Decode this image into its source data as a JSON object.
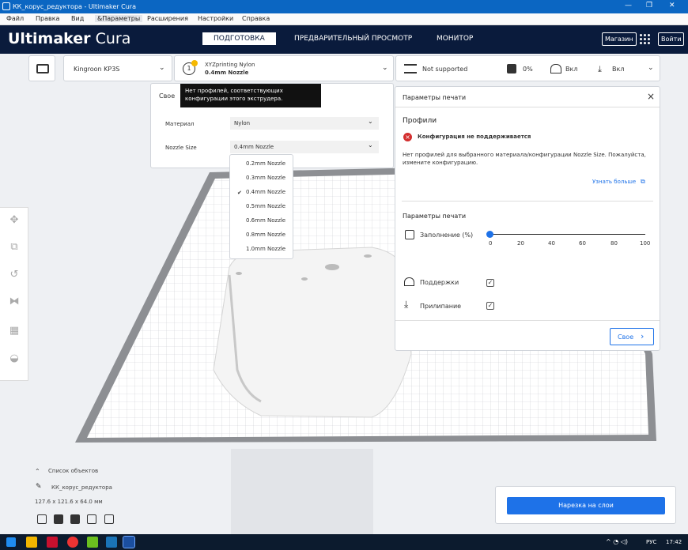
{
  "window": {
    "title": "КК_корус_редуктора - Ultimaker Cura",
    "controls": [
      "—",
      "❐",
      "✕"
    ]
  },
  "menu": [
    "Файл",
    "Правка",
    "Вид",
    "&Параметры",
    "Расширения",
    "Настройки",
    "Справка"
  ],
  "header": {
    "logo_bold": "Ultimaker",
    "logo_light": "Cura",
    "stages": [
      "ПОДГОТОВКА",
      "ПРЕДВАРИТЕЛЬНЫЙ ПРОСМОТР",
      "МОНИТОР"
    ],
    "store": "Магазин",
    "login": "Войти"
  },
  "toolbar": {
    "printer": "Kingroon KP3S",
    "material_name": "XYZprinting Nylon",
    "nozzle": "0.4mm Nozzle",
    "profile": "Not supported",
    "infill_pct": "0%",
    "support": "Вкл",
    "adhesion": "Вкл"
  },
  "tooltip": {
    "text": "Нет профилей, соответствующих конфигурации этого экструдера."
  },
  "extruder_panel": {
    "tab": "Свое",
    "material_label": "Материал",
    "material_value": "Nylon",
    "nozzle_label": "Nozzle Size",
    "nozzle_value": "0.4mm Nozzle"
  },
  "nozzle_options": [
    "0.2mm Nozzle",
    "0.3mm Nozzle",
    "0.4mm Nozzle",
    "0.5mm Nozzle",
    "0.6mm Nozzle",
    "0.8mm Nozzle",
    "1.0mm Nozzle"
  ],
  "nozzle_selected": "0.4mm Nozzle",
  "print_settings": {
    "title": "Параметры печати",
    "profiles_label": "Профили",
    "error": "Конфигурация не поддерживается",
    "error_desc": "Нет профилей для выбранного материала/конфигурации Nozzle Size. Пожалуйста, измените конфигурацию.",
    "learn_more": "Узнать больше",
    "section": "Параметры печати",
    "infill_label": "Заполнение (%)",
    "infill_ticks": [
      "0",
      "20",
      "40",
      "60",
      "80",
      "100"
    ],
    "support_label": "Поддержки",
    "adhesion_label": "Прилипание",
    "custom_btn": "Свое",
    "close": "×"
  },
  "objects": {
    "toggle": "Список объектов",
    "name": "КК_корус_редуктора",
    "dims": "127.6 x 121.6 x 64.0 мм"
  },
  "slice": {
    "label": "Нарезка на слои"
  },
  "taskbar": {
    "lang": "РУС",
    "time": "17:42"
  },
  "colors": {
    "accent": "#1e72e8",
    "header": "#0a1b3c",
    "titlebar": "#0b66c2",
    "error": "#d32f2f",
    "warning": "#f5b800"
  }
}
